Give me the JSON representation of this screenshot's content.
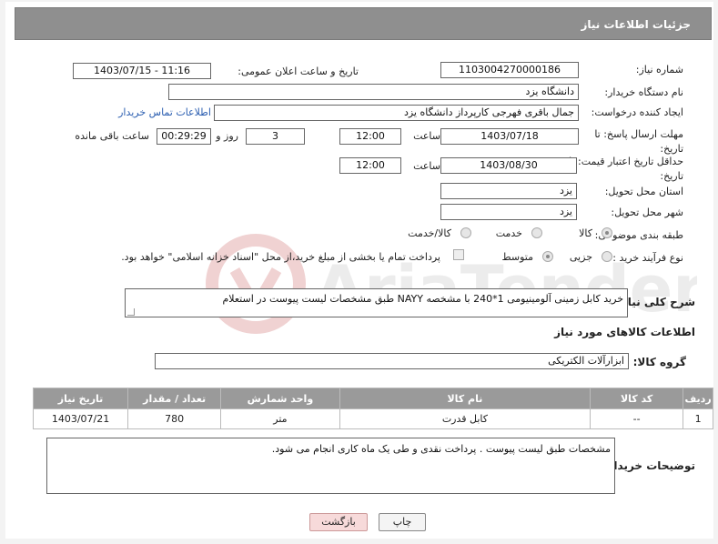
{
  "header": {
    "title": "جزئیات اطلاعات نیاز"
  },
  "fields": {
    "need_number_label": "شماره نیاز:",
    "need_number": "1103004270000186",
    "announce_label": "تاریخ و ساعت اعلان عمومی:",
    "announce_value": "1403/07/15 - 11:16",
    "buyer_org_label": "نام دستگاه خریدار:",
    "buyer_org": "دانشگاه یزد",
    "creator_label": "ایجاد کننده درخواست:",
    "creator": "جمال باقری فهرجی کارپرداز دانشگاه یزد",
    "contact_link": "اطلاعات تماس خریدار",
    "deadline_label": "مهلت ارسال پاسخ: تا تاریخ:",
    "deadline_date": "1403/07/18",
    "time_label": "ساعت",
    "deadline_time": "12:00",
    "days": "3",
    "days_label": "روز و",
    "remaining_time": "00:29:29",
    "remaining_label": "ساعت باقی مانده",
    "min_validity_label": "حداقل تاریخ اعتبار قیمت: تا تاریخ:",
    "validity_date": "1403/08/30",
    "validity_time": "12:00",
    "province_label": "استان محل تحویل:",
    "province": "یزد",
    "city_label": "شهر محل تحویل:",
    "city": "یزد",
    "category_label": "طبقه بندی موضوعی:",
    "category_options": [
      "کالا",
      "خدمت",
      "کالا/خدمت"
    ],
    "process_label": "نوع فرآیند خرید :",
    "process_options": [
      "جزیی",
      "متوسط"
    ],
    "payment_note": "پرداخت تمام یا بخشی از مبلغ خرید،از محل \"اسناد خزانه اسلامی\" خواهد بود.",
    "summary_label": "شرح کلی نیاز:",
    "summary": "خرید کابل زمینی آلومینیومی 1*240 با مشخصه NAYY طبق مشخصات لیست پیوست در استعلام",
    "goods_info_title": "اطلاعات کالاهای مورد نیاز",
    "goods_group_label": "گروه کالا:",
    "goods_group": "ابزارآلات الکتریکی",
    "buyer_notes_label": "توضیحات خریدار:",
    "buyer_notes": "مشخصات طبق لیست پیوست . پرداخت نقدی و طی یک ماه کاری انجام می شود."
  },
  "table": {
    "headers": [
      "ردیف",
      "کد کالا",
      "نام کالا",
      "واحد شمارش",
      "تعداد / مقدار",
      "تاریخ نیاز"
    ],
    "rows": [
      [
        "1",
        "--",
        "کابل قدرت",
        "متر",
        "780",
        "1403/07/21"
      ]
    ]
  },
  "buttons": {
    "print": "چاپ",
    "back": "بازگشت"
  },
  "colors": {
    "header_bg": "#8f8f8f",
    "table_header_bg": "#9a9a9a",
    "link": "#2a5db0",
    "back_btn_bg": "#f7dada"
  }
}
